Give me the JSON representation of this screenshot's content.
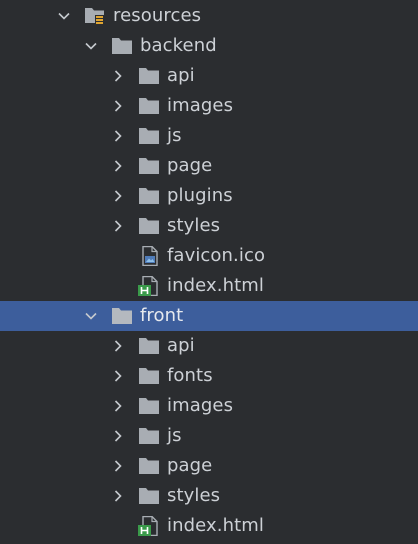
{
  "colors": {
    "background": "#2b2d30",
    "selection": "#3d5e9c",
    "folder": "#a8adb3",
    "text": "#cdd1d6",
    "html_badge": "#3a9a4a"
  },
  "tree": {
    "resources": {
      "label": "resources",
      "icon": "resources-folder-icon",
      "expanded": true
    },
    "backend": {
      "label": "backend",
      "icon": "folder-icon",
      "expanded": true,
      "children": [
        {
          "label": "api",
          "type": "folder",
          "expanded": false
        },
        {
          "label": "images",
          "type": "folder",
          "expanded": false
        },
        {
          "label": "js",
          "type": "folder",
          "expanded": false
        },
        {
          "label": "page",
          "type": "folder",
          "expanded": false
        },
        {
          "label": "plugins",
          "type": "folder",
          "expanded": false
        },
        {
          "label": "styles",
          "type": "folder",
          "expanded": false
        },
        {
          "label": "favicon.ico",
          "type": "image-file"
        },
        {
          "label": "index.html",
          "type": "html-file"
        }
      ]
    },
    "front": {
      "label": "front",
      "icon": "folder-icon",
      "expanded": true,
      "selected": true,
      "children": [
        {
          "label": "api",
          "type": "folder",
          "expanded": false
        },
        {
          "label": "fonts",
          "type": "folder",
          "expanded": false
        },
        {
          "label": "images",
          "type": "folder",
          "expanded": false
        },
        {
          "label": "js",
          "type": "folder",
          "expanded": false
        },
        {
          "label": "page",
          "type": "folder",
          "expanded": false
        },
        {
          "label": "styles",
          "type": "folder",
          "expanded": false
        },
        {
          "label": "index.html",
          "type": "html-file"
        }
      ]
    }
  }
}
